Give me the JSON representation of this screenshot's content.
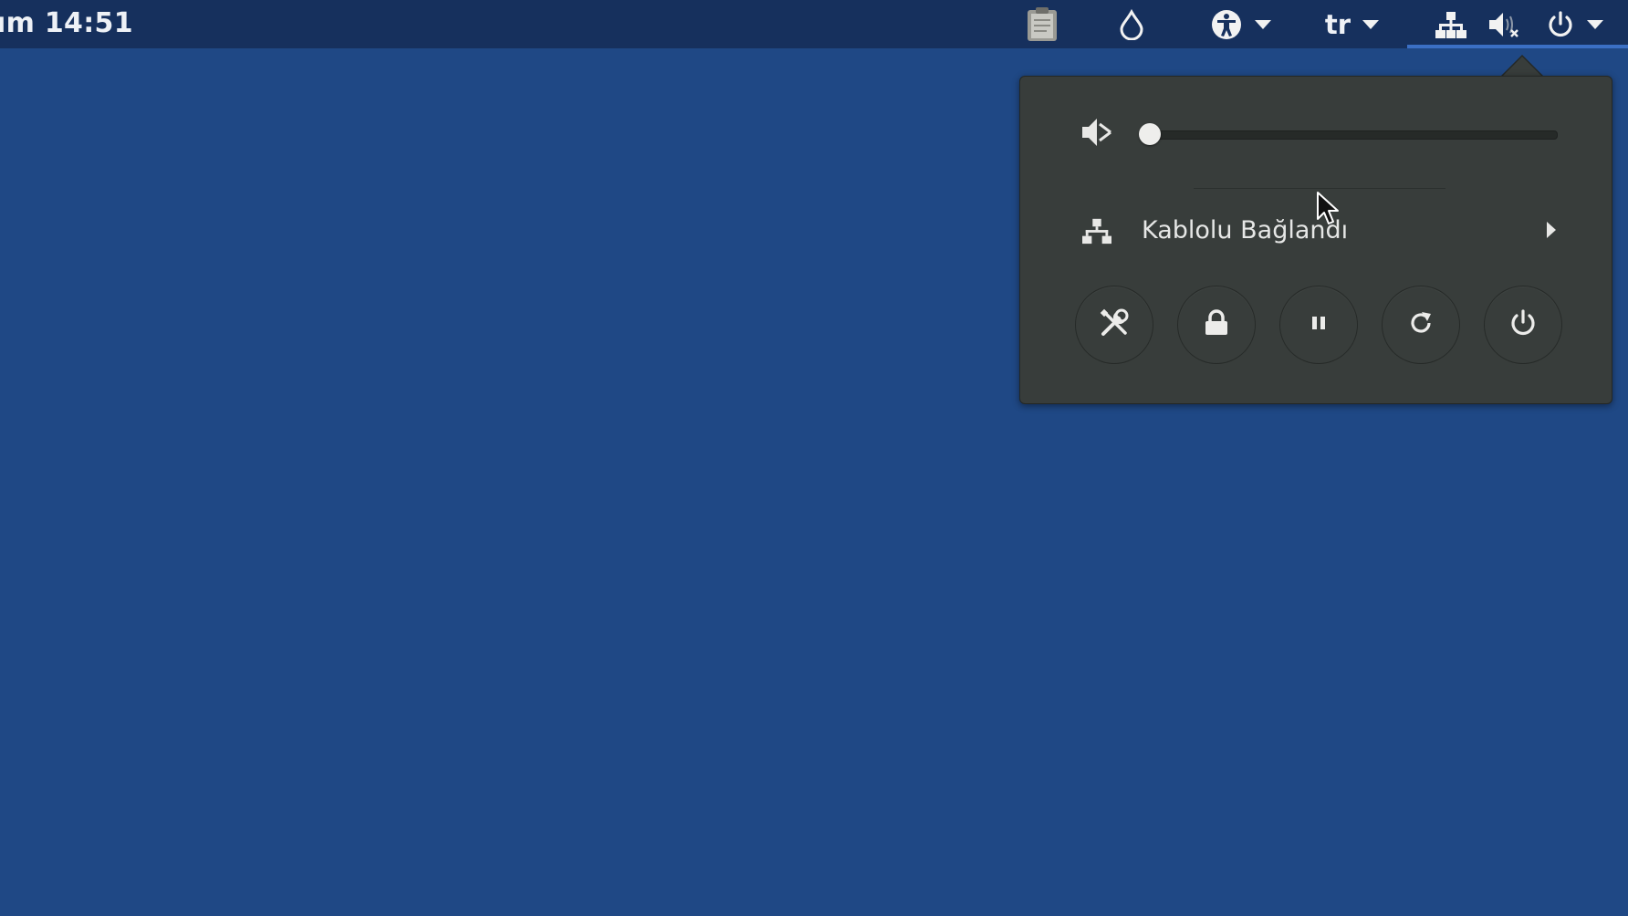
{
  "topbar": {
    "clock": "ım 14:51",
    "language": "tr",
    "icons": {
      "clipboard": "clipboard-icon",
      "drop": "drop-icon",
      "accessibility": "accessibility-icon",
      "network": "wired-network-icon",
      "volume": "volume-muted-icon",
      "power": "power-icon"
    }
  },
  "popup": {
    "volume": {
      "icon": "volume-muted-icon",
      "level": 0
    },
    "network": {
      "icon": "wired-network-icon",
      "label": "Kablolu Bağlandı"
    },
    "buttons": [
      {
        "name": "settings",
        "icon": "tools-icon"
      },
      {
        "name": "lock",
        "icon": "lock-icon"
      },
      {
        "name": "suspend",
        "icon": "pause-icon"
      },
      {
        "name": "restart",
        "icon": "restart-icon"
      },
      {
        "name": "power-off",
        "icon": "power-icon"
      }
    ]
  },
  "colors": {
    "desktop": "#1f4885",
    "topbar": "#16305d",
    "popup": "#383d3b",
    "accent": "#3b6fc4"
  }
}
